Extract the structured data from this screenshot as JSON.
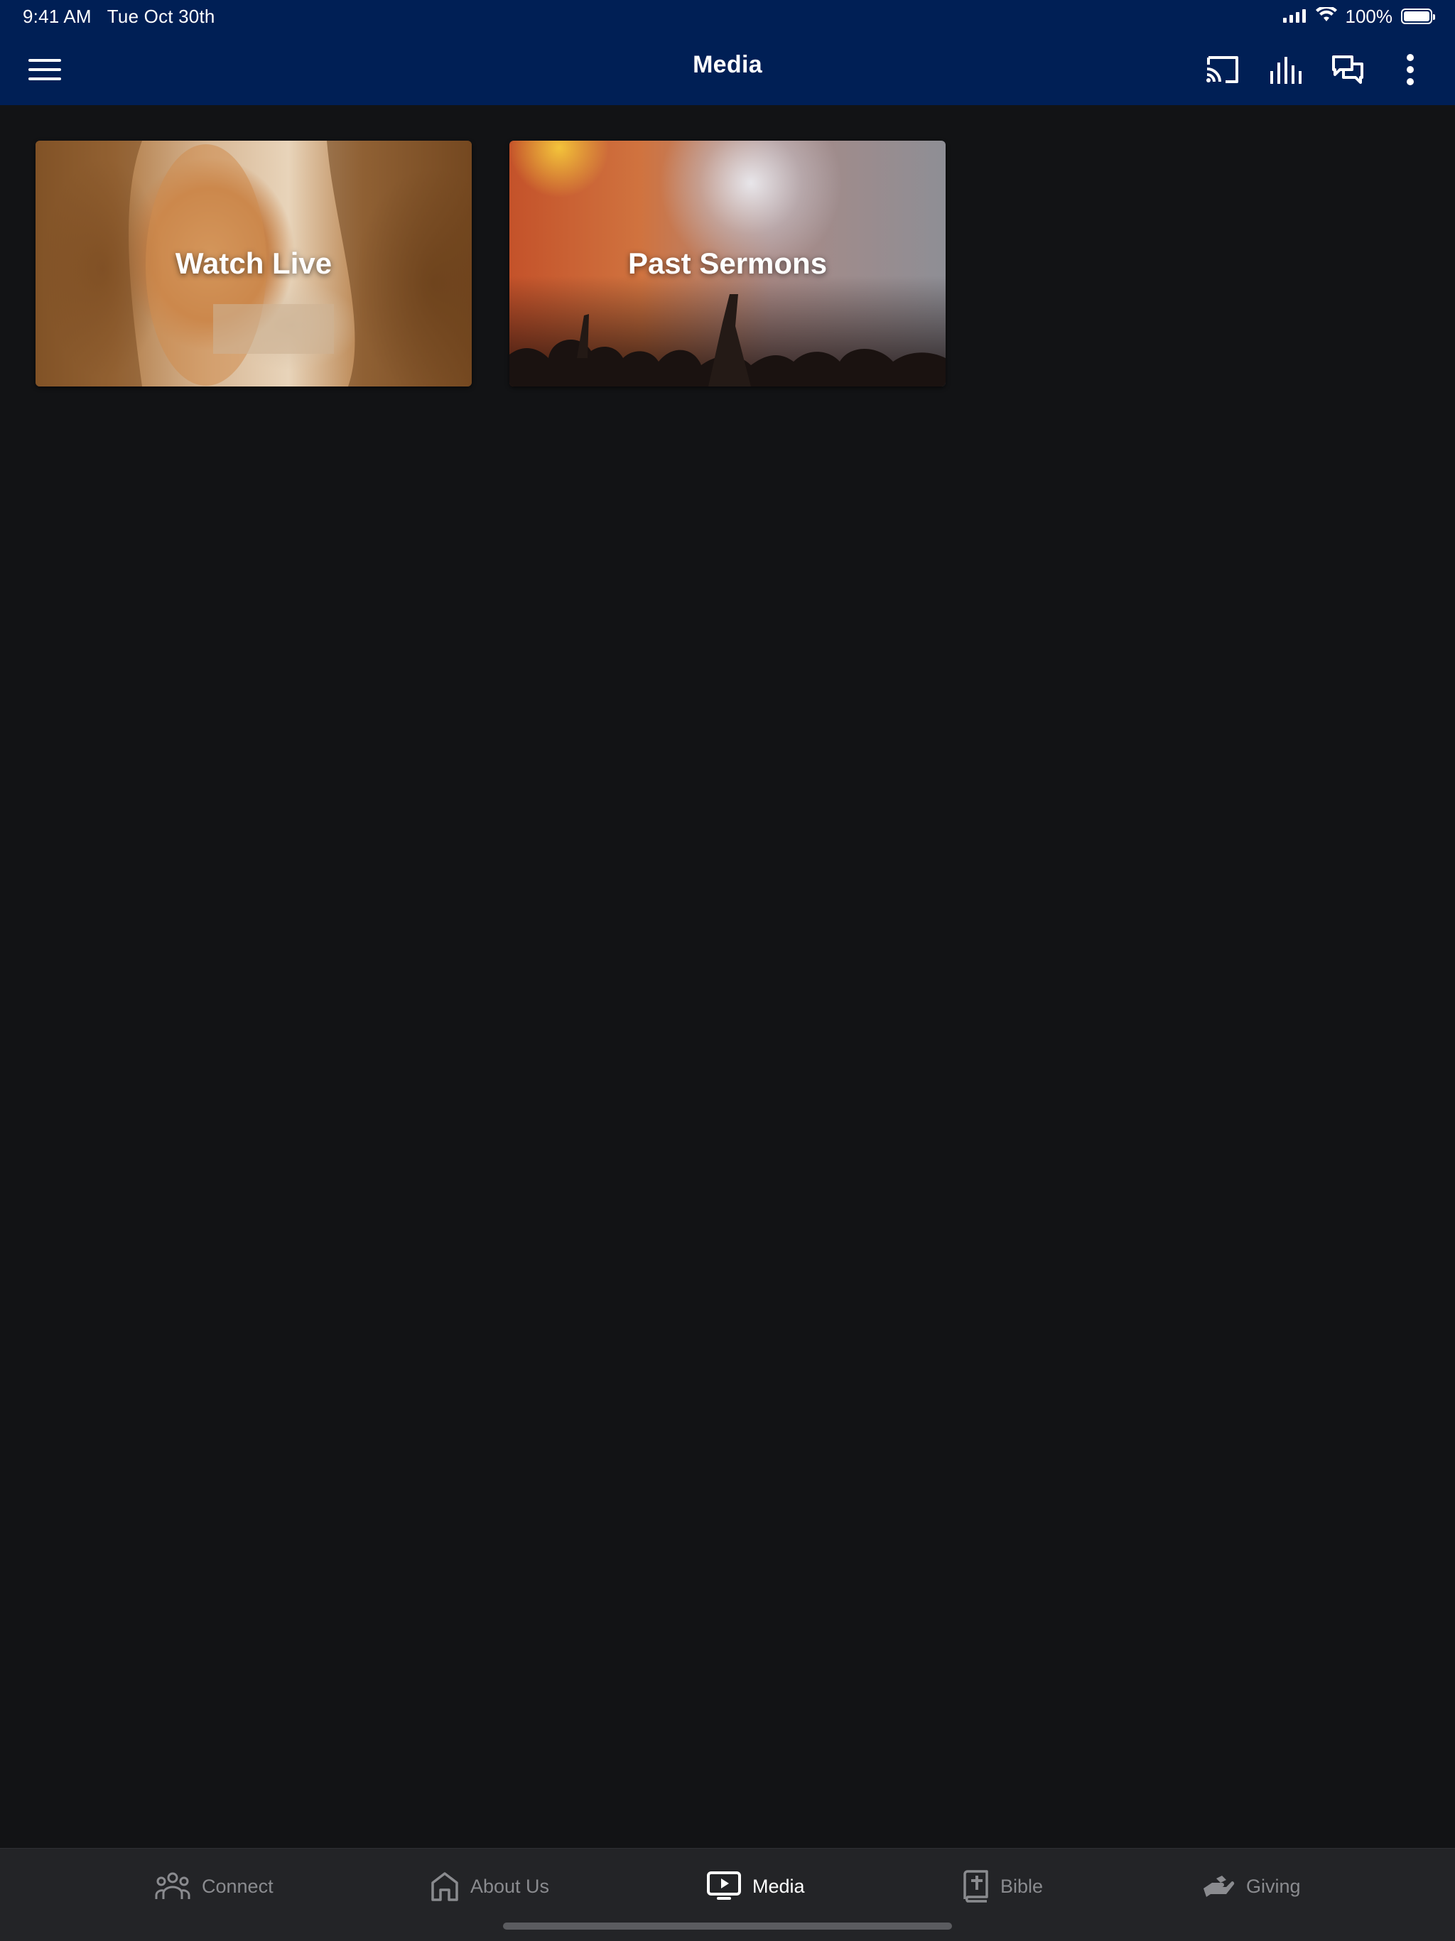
{
  "status_bar": {
    "time": "9:41 AM",
    "date": "Tue Oct 30th",
    "battery_text": "100%",
    "battery_level": 1.0
  },
  "header": {
    "title": "Media",
    "background_color": "#001f55",
    "icons": {
      "menu": "hamburger-menu-icon",
      "cast": "cast-icon",
      "audio": "audio-bars-icon",
      "chat": "chat-icon",
      "more": "more-vertical-icon"
    }
  },
  "cards": [
    {
      "label": "Watch Live"
    },
    {
      "label": "Past Sermons"
    }
  ],
  "tabs": [
    {
      "label": "Connect",
      "icon": "people-icon",
      "active": false
    },
    {
      "label": "About Us",
      "icon": "home-icon",
      "active": false
    },
    {
      "label": "Media",
      "icon": "tv-play-icon",
      "active": true
    },
    {
      "label": "Bible",
      "icon": "bible-icon",
      "active": false
    },
    {
      "label": "Giving",
      "icon": "giving-hand-icon",
      "active": false
    }
  ],
  "colors": {
    "background": "#121315",
    "tabbar": "#232427",
    "tab_inactive": "#8a8b8f",
    "tab_active": "#ffffff"
  }
}
